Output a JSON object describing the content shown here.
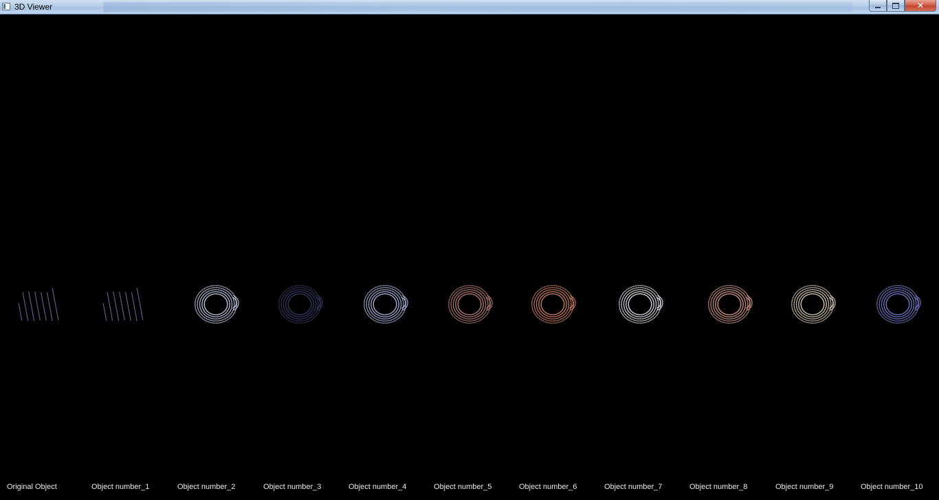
{
  "window": {
    "title": "3D Viewer",
    "buttons": {
      "minimize": "minimize",
      "maximize": "maximize",
      "close": "✕"
    }
  },
  "objects": [
    {
      "label": "Original Object",
      "color": "#8a9ad0",
      "shape": "cloud"
    },
    {
      "label": "Object number_1",
      "color": "#8a9ad0",
      "shape": "cloud"
    },
    {
      "label": "Object number_2",
      "color": "#cfd8f5",
      "shape": "mug"
    },
    {
      "label": "Object number_3",
      "color": "#3a3f6a",
      "shape": "mug"
    },
    {
      "label": "Object number_4",
      "color": "#b9c6ef",
      "shape": "mug"
    },
    {
      "label": "Object number_5",
      "color": "#c88a7e",
      "shape": "mug"
    },
    {
      "label": "Object number_6",
      "color": "#e08c6c",
      "shape": "mug"
    },
    {
      "label": "Object number_7",
      "color": "#f0f2fb",
      "shape": "mug"
    },
    {
      "label": "Object number_8",
      "color": "#e6a896",
      "shape": "mug"
    },
    {
      "label": "Object number_9",
      "color": "#eddcc9",
      "shape": "mug"
    },
    {
      "label": "Object number_10",
      "color": "#7c86d8",
      "shape": "mug"
    }
  ]
}
